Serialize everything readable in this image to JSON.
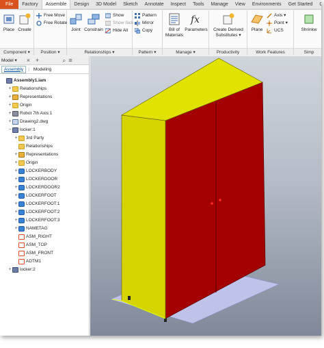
{
  "tabs": [
    "File",
    "Factory",
    "Assemble",
    "Design",
    "3D Model",
    "Sketch",
    "Annotate",
    "Inspect",
    "Tools",
    "Manage",
    "View",
    "Environments",
    "Get Started",
    "Collab"
  ],
  "active_tab": "Assemble",
  "ribbon": {
    "component": {
      "title": "Component ▾",
      "place": "Place",
      "create": "Create"
    },
    "position": {
      "title": "Position ▾",
      "free_move": "Free Move",
      "free_rotate": "Free Rotate"
    },
    "relationships": {
      "title": "Relationships ▾",
      "joint": "Joint",
      "constrain": "Constrain",
      "show": "Show",
      "show_sick": "Show Sick",
      "hide_all": "Hide All"
    },
    "pattern": {
      "title": "Pattern ▾",
      "pattern": "Pattern",
      "mirror": "Mirror",
      "copy": "Copy"
    },
    "manage": {
      "title": "Manage ▾",
      "bom": "Bill of\nMaterials",
      "bom_l1": "Bill of",
      "bom_l2": "Materials",
      "parameters": "Parameters"
    },
    "productivity": {
      "title": "Productivity",
      "create_derived_l1": "Create Derived",
      "create_derived_l2": "Substitutes ▾"
    },
    "work_features": {
      "title": "Work Features",
      "plane": "Plane",
      "axis": "Axis ▾",
      "point": "Point ▾",
      "ucs": "UCS"
    },
    "simplification": {
      "title": "Simp",
      "shrinkwrap": "Shrinkw"
    }
  },
  "browser": {
    "header": "Model ▾",
    "add": "+",
    "tabs": [
      "Assembly",
      "Modeling"
    ],
    "active_tab": "Assembly",
    "nodes": [
      {
        "label": "Assembly1.iam",
        "bold": true,
        "icon": "asm",
        "exp": "",
        "indent": 0
      },
      {
        "label": "Relationships",
        "icon": "folder",
        "exp": "+",
        "indent": 1
      },
      {
        "label": "Representations",
        "icon": "rep",
        "exp": "+",
        "indent": 1
      },
      {
        "label": "Origin",
        "icon": "folder",
        "exp": "+",
        "indent": 1
      },
      {
        "label": "Robot 7th Axis:1",
        "icon": "robot",
        "exp": "+",
        "indent": 1
      },
      {
        "label": "Drawing2.dwg",
        "icon": "dwg",
        "exp": "+",
        "indent": 1
      },
      {
        "label": "locker:1",
        "icon": "asm",
        "exp": "−",
        "indent": 1
      },
      {
        "label": "3rd Party",
        "icon": "folder",
        "exp": "+",
        "indent": 2
      },
      {
        "label": "Relationships",
        "icon": "folder",
        "exp": "",
        "indent": 2
      },
      {
        "label": "Representations",
        "icon": "rep",
        "exp": "+",
        "indent": 2
      },
      {
        "label": "Origin",
        "icon": "folder",
        "exp": "+",
        "indent": 2
      },
      {
        "label": "LOCKERBODY",
        "icon": "part",
        "exp": "+",
        "indent": 2
      },
      {
        "label": "LOCKERDOOR",
        "icon": "part",
        "exp": "+",
        "indent": 2
      },
      {
        "label": "LOCKERDOOR2",
        "icon": "part",
        "exp": "+",
        "indent": 2
      },
      {
        "label": "LOCKERFOOT",
        "icon": "part",
        "exp": "+",
        "indent": 2
      },
      {
        "label": "LOCKERFOOT:1",
        "icon": "part",
        "exp": "+",
        "indent": 2
      },
      {
        "label": "LOCKERFOOT:2",
        "icon": "part",
        "exp": "+",
        "indent": 2
      },
      {
        "label": "LOCKERFOOT:3",
        "icon": "part",
        "exp": "+",
        "indent": 2
      },
      {
        "label": "NAMETAG",
        "icon": "part",
        "exp": "+",
        "indent": 2
      },
      {
        "label": "ASM_RIGHT",
        "icon": "sketch",
        "exp": "",
        "indent": 2
      },
      {
        "label": "ASM_TOP",
        "icon": "sketch",
        "exp": "",
        "indent": 2
      },
      {
        "label": "ASM_FRONT",
        "icon": "sketch",
        "exp": "",
        "indent": 2
      },
      {
        "label": "ADTM1",
        "icon": "sketch",
        "exp": "",
        "indent": 2
      },
      {
        "label": "locker:2",
        "icon": "asm",
        "exp": "+",
        "indent": 1
      }
    ]
  },
  "colors": {
    "file_tab": "#d9531e",
    "cabinet_side": "#d6d400",
    "cabinet_top": "#e2e200",
    "cabinet_front": "#a30000",
    "ground": "#bfc3ea"
  }
}
